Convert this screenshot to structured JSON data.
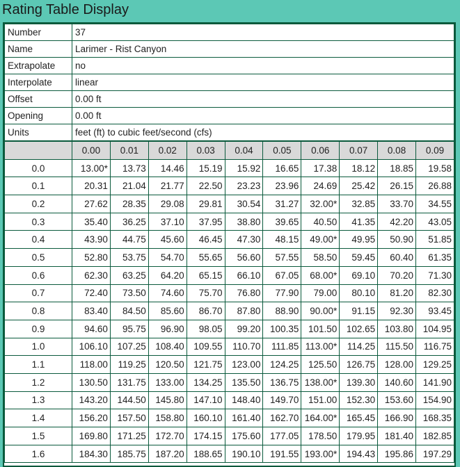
{
  "window": {
    "title": "Rating Table Display"
  },
  "info": [
    {
      "label": "Number",
      "value": "37"
    },
    {
      "label": "Name",
      "value": "Larimer - Rist Canyon"
    },
    {
      "label": "Extrapolate",
      "value": "no"
    },
    {
      "label": "Interpolate",
      "value": "linear"
    },
    {
      "label": "Offset",
      "value": "0.00 ft"
    },
    {
      "label": "Opening",
      "value": "0.00 ft"
    },
    {
      "label": "Units",
      "value": "feet (ft) to cubic feet/second (cfs)"
    }
  ],
  "table": {
    "columns": [
      "0.00",
      "0.01",
      "0.02",
      "0.03",
      "0.04",
      "0.05",
      "0.06",
      "0.07",
      "0.08",
      "0.09"
    ],
    "rows": [
      {
        "head": "0.0",
        "cells": [
          "13.00*",
          "13.73",
          "14.46",
          "15.19",
          "15.92",
          "16.65",
          "17.38",
          "18.12",
          "18.85",
          "19.58"
        ]
      },
      {
        "head": "0.1",
        "cells": [
          "20.31",
          "21.04",
          "21.77",
          "22.50",
          "23.23",
          "23.96",
          "24.69",
          "25.42",
          "26.15",
          "26.88"
        ]
      },
      {
        "head": "0.2",
        "cells": [
          "27.62",
          "28.35",
          "29.08",
          "29.81",
          "30.54",
          "31.27",
          "32.00*",
          "32.85",
          "33.70",
          "34.55"
        ]
      },
      {
        "head": "0.3",
        "cells": [
          "35.40",
          "36.25",
          "37.10",
          "37.95",
          "38.80",
          "39.65",
          "40.50",
          "41.35",
          "42.20",
          "43.05"
        ]
      },
      {
        "head": "0.4",
        "cells": [
          "43.90",
          "44.75",
          "45.60",
          "46.45",
          "47.30",
          "48.15",
          "49.00*",
          "49.95",
          "50.90",
          "51.85"
        ]
      },
      {
        "head": "0.5",
        "cells": [
          "52.80",
          "53.75",
          "54.70",
          "55.65",
          "56.60",
          "57.55",
          "58.50",
          "59.45",
          "60.40",
          "61.35"
        ]
      },
      {
        "head": "0.6",
        "cells": [
          "62.30",
          "63.25",
          "64.20",
          "65.15",
          "66.10",
          "67.05",
          "68.00*",
          "69.10",
          "70.20",
          "71.30"
        ]
      },
      {
        "head": "0.7",
        "cells": [
          "72.40",
          "73.50",
          "74.60",
          "75.70",
          "76.80",
          "77.90",
          "79.00",
          "80.10",
          "81.20",
          "82.30"
        ]
      },
      {
        "head": "0.8",
        "cells": [
          "83.40",
          "84.50",
          "85.60",
          "86.70",
          "87.80",
          "88.90",
          "90.00*",
          "91.15",
          "92.30",
          "93.45"
        ]
      },
      {
        "head": "0.9",
        "cells": [
          "94.60",
          "95.75",
          "96.90",
          "98.05",
          "99.20",
          "100.35",
          "101.50",
          "102.65",
          "103.80",
          "104.95"
        ]
      },
      {
        "head": "1.0",
        "cells": [
          "106.10",
          "107.25",
          "108.40",
          "109.55",
          "110.70",
          "111.85",
          "113.00*",
          "114.25",
          "115.50",
          "116.75"
        ]
      },
      {
        "head": "1.1",
        "cells": [
          "118.00",
          "119.25",
          "120.50",
          "121.75",
          "123.00",
          "124.25",
          "125.50",
          "126.75",
          "128.00",
          "129.25"
        ]
      },
      {
        "head": "1.2",
        "cells": [
          "130.50",
          "131.75",
          "133.00",
          "134.25",
          "135.50",
          "136.75",
          "138.00*",
          "139.30",
          "140.60",
          "141.90"
        ]
      },
      {
        "head": "1.3",
        "cells": [
          "143.20",
          "144.50",
          "145.80",
          "147.10",
          "148.40",
          "149.70",
          "151.00",
          "152.30",
          "153.60",
          "154.90"
        ]
      },
      {
        "head": "1.4",
        "cells": [
          "156.20",
          "157.50",
          "158.80",
          "160.10",
          "161.40",
          "162.70",
          "164.00*",
          "165.45",
          "166.90",
          "168.35"
        ]
      },
      {
        "head": "1.5",
        "cells": [
          "169.80",
          "171.25",
          "172.70",
          "174.15",
          "175.60",
          "177.05",
          "178.50",
          "179.95",
          "181.40",
          "182.85"
        ]
      },
      {
        "head": "1.6",
        "cells": [
          "184.30",
          "185.75",
          "187.20",
          "188.65",
          "190.10",
          "191.55",
          "193.00*",
          "194.43",
          "195.86",
          "197.29"
        ]
      }
    ]
  }
}
